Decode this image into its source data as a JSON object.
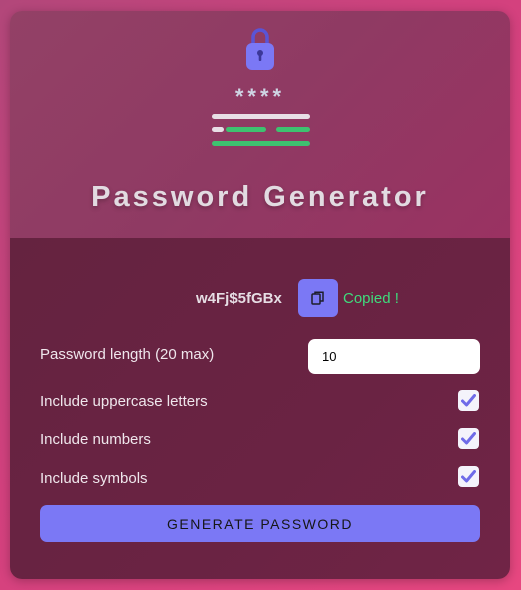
{
  "header": {
    "mask": "****",
    "title": "Password Generator"
  },
  "result": {
    "password": "w4Fj$5fGBx",
    "copy_icon": "copy-icon",
    "copied_text": "Copied !"
  },
  "options": {
    "length_label": "Password length (20 max)",
    "length_value": "10",
    "uppercase_label": "Include uppercase letters",
    "uppercase_checked": true,
    "numbers_label": "Include numbers",
    "numbers_checked": true,
    "symbols_label": "Include symbols",
    "symbols_checked": true
  },
  "generate_label": "GENERATE PASSWORD",
  "colors": {
    "accent": "#7b78f5",
    "success": "#3fdb7c",
    "background": "#e74780"
  }
}
